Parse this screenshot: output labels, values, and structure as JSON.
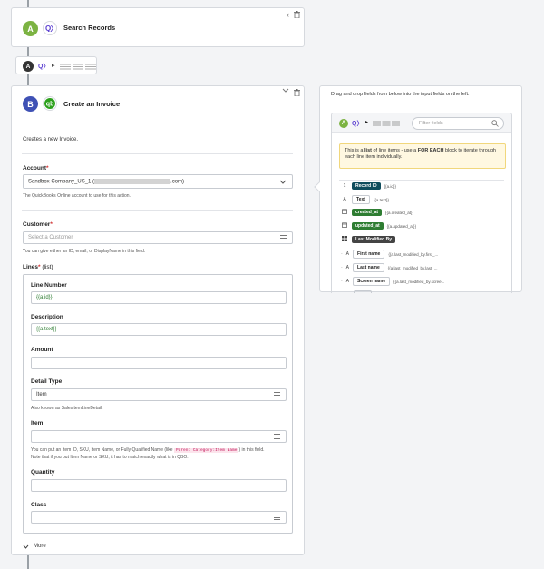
{
  "step_a": {
    "badge": "A",
    "title": "Search Records",
    "chevron": "‹",
    "trash": "🗑"
  },
  "connector": {
    "badge": "A",
    "arrow": "▸"
  },
  "step_b": {
    "badge": "B",
    "title": "Create an Invoice",
    "description": "Creates a new Invoice.",
    "account": {
      "label": "Account",
      "value": "Sandbox Company_US_1 (",
      "value_end": ".com)",
      "help": "The QuickBooks Online account to use for this action."
    },
    "customer": {
      "label": "Customer",
      "placeholder": "Select a Customer",
      "help": "You can give either an ID, email, or DisplayName in this field."
    },
    "lines": {
      "label": "Lines",
      "suffix": "(list)"
    },
    "line_number": {
      "label": "Line Number",
      "value": "{{a.id}}"
    },
    "desc_field": {
      "label": "Description",
      "value": "{{a.text}}"
    },
    "amount": {
      "label": "Amount",
      "value": ""
    },
    "detail_type": {
      "label": "Detail Type",
      "value": "Item",
      "help": "Also known as SalesItemLineDetail."
    },
    "item": {
      "label": "Item",
      "value": "",
      "help1": "You can put an Item ID, SKU, Item Name, or Fully Qualified Name (like ",
      "code": "Parent Category:Item Name",
      "help1_end": ") in this field.",
      "help2": "Note that if you put Item Name or SKU, it has to match exactly what is in QBO."
    },
    "quantity": {
      "label": "Quantity",
      "value": ""
    },
    "class_field": {
      "label": "Class",
      "value": ""
    },
    "more": "More"
  },
  "side_panel": {
    "header": "Drag and drop fields from below into the input fields on the left.",
    "filter_placeholder": "Filter fields",
    "notice_pre": "This is a ",
    "notice_list": "list",
    "notice_mid": " of line items - use a ",
    "notice_for": "FOR EACH",
    "notice_post": " block to iterate through each line item individually.",
    "fields": [
      {
        "type": "1",
        "label": "Record ID",
        "tpl": "{{a.id}}"
      },
      {
        "type": "A",
        "label": "Text",
        "tpl": "{{a.text}}"
      },
      {
        "type": "cal",
        "label": "created_at",
        "tpl": "{{a.created_at}}"
      },
      {
        "type": "cal",
        "label": "updated_at",
        "tpl": "{{a.updated_at}}"
      },
      {
        "type": "grid",
        "label": "Last Modified By",
        "tpl": ""
      },
      {
        "type": "A",
        "label": "First name",
        "tpl": "{{a.last_modified_by.first_..."
      },
      {
        "type": "A",
        "label": "Last name",
        "tpl": "{{a.last_modified_by.last_..."
      },
      {
        "type": "A",
        "label": "Screen name",
        "tpl": "{{a.last_modified_by.scree..."
      }
    ]
  }
}
